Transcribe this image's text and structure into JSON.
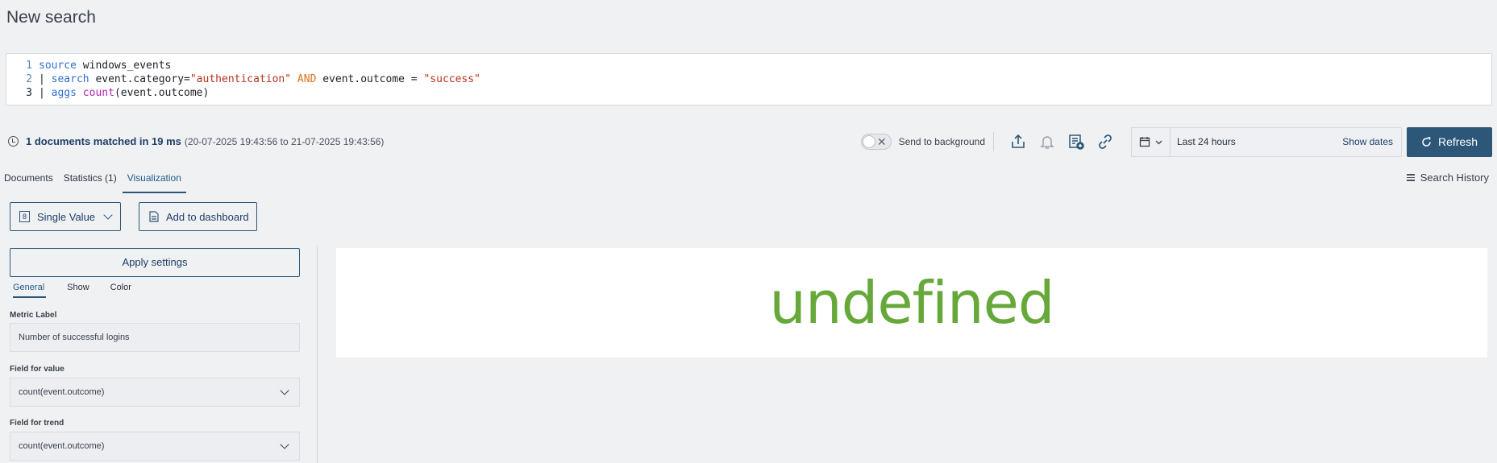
{
  "page": {
    "title": "New search"
  },
  "query": {
    "lines": [
      {
        "num": "1",
        "parts": {
          "a": "source",
          "b": " windows_events"
        }
      },
      {
        "num": "2",
        "parts": {
          "pipe": "| ",
          "kw": "search",
          "t1": " event.category=",
          "s1": "\"authentication\"",
          "and": " AND",
          "t2": " event.outcome = ",
          "s2": "\"success\""
        }
      },
      {
        "num": "3",
        "parts": {
          "pipe": "| ",
          "kw": "aggs",
          "fn": " count",
          "t1": "(event.outcome)"
        }
      }
    ]
  },
  "status": {
    "matched": "1 documents matched in 19 ms",
    "range": "(20-07-2025 19:43:56 to 21-07-2025 19:43:56)"
  },
  "toolbar": {
    "send_bg_label": "Send to background",
    "send_bg_enabled": false,
    "toggle_x": "✕",
    "time_range": "Last 24 hours",
    "show_dates": "Show dates",
    "refresh_label": "Refresh",
    "accent": "#2d5779"
  },
  "tabs": [
    {
      "label": "Documents",
      "active": false
    },
    {
      "label": "Statistics (1)",
      "active": false
    },
    {
      "label": "Visualization",
      "active": true
    }
  ],
  "history_label": "Search History",
  "viz": {
    "type_badge": "8",
    "type_label": "Single Value",
    "add_dashboard_label": "Add to dashboard",
    "apply_label": "Apply settings",
    "subtabs": [
      {
        "label": "General",
        "active": true
      },
      {
        "label": "Show",
        "active": false
      },
      {
        "label": "Color",
        "active": false
      }
    ],
    "fields": {
      "metric_label_title": "Metric Label",
      "metric_label_value": "Number of successful logins",
      "value_field_title": "Field for value",
      "value_field_value": "count(event.outcome)",
      "trend_field_title": "Field for trend",
      "trend_field_value": "count(event.outcome)"
    },
    "result_value": "undefined",
    "result_color": "#67a83a"
  }
}
